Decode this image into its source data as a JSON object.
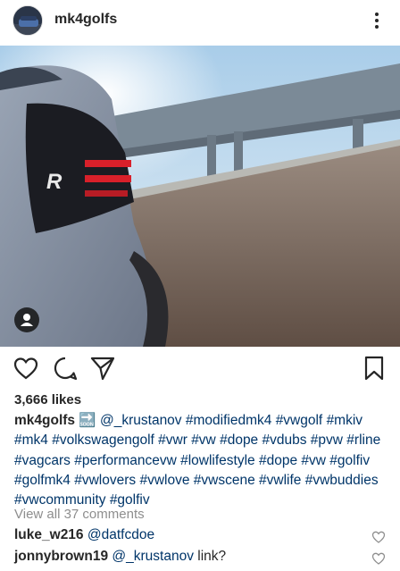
{
  "post": {
    "username": "mk4golfs",
    "icons": {
      "more": "more-vertical-icon",
      "tag": "user-tag-icon"
    }
  },
  "actions": {
    "like_icon": "heart-icon",
    "comment_icon": "comment-icon",
    "share_icon": "send-icon",
    "save_icon": "bookmark-icon"
  },
  "likes": "3,666 likes",
  "caption": {
    "username": "mk4golfs",
    "emoji": "🔜",
    "mention": "@_krustanov",
    "hashtags": [
      "#modifiedmk4",
      "#vwgolf",
      "#mkiv",
      "#mk4",
      "#volkswagengolf",
      "#vwr",
      "#vw",
      "#dope",
      "#vdubs",
      "#pvw",
      "#rline",
      "#vagcars",
      "#performancevw",
      "#lowlifestyle",
      "#dope",
      "#vw",
      "#golfiv",
      "#golfmk4",
      "#vwlovers",
      "#vwlove",
      "#vwscene",
      "#vwlife",
      "#vwbuddies",
      "#vwcommunity",
      "#golfiv"
    ]
  },
  "view_all_comments": "View all 37 comments",
  "comments": [
    {
      "username": "luke_w216",
      "mention": "@datfcdoe",
      "text": ""
    },
    {
      "username": "jonnybrown19",
      "mention": "@_krustanov",
      "text": " link?"
    }
  ],
  "photo": {
    "badge_text": "R",
    "colors": {
      "sky": "#b9d8ee",
      "car_body": "#8a95a6",
      "road": "#7a6a5e",
      "taillight_red": "#d8202a"
    }
  }
}
